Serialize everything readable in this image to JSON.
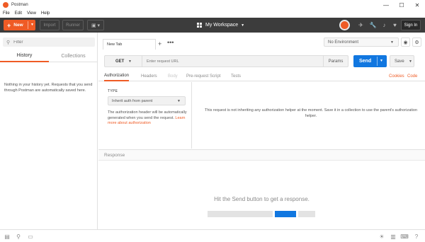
{
  "window": {
    "title": "Postman",
    "controls": {
      "minimize": "—",
      "maximize": "☐",
      "close": "✕"
    }
  },
  "menu": [
    "File",
    "Edit",
    "View",
    "Help"
  ],
  "toolbar": {
    "new_label": "New",
    "import_label": "Import",
    "runner_label": "Runner",
    "workspace_label": "My Workspace",
    "signin_label": "Sign In"
  },
  "sidebar": {
    "filter_placeholder": "Filter",
    "tabs": [
      "History",
      "Collections"
    ],
    "active_tab": "History",
    "empty_message": "Nothing in your history yet. Requests that you send through Postman are automatically saved here."
  },
  "request_tab": {
    "label": "New Tab"
  },
  "environment": {
    "selected": "No Environment"
  },
  "request": {
    "method": "GET",
    "url_placeholder": "Enter request URL",
    "params_label": "Params",
    "send_label": "Send",
    "save_label": "Save"
  },
  "subtabs": [
    "Authorization",
    "Headers",
    "Body",
    "Pre-request Script",
    "Tests"
  ],
  "subtab_links": [
    "Cookies",
    "Code"
  ],
  "auth": {
    "type_label": "TYPE",
    "type_value": "Inherit auth from parent",
    "desc_text": "The authorization header will be automatically generated when you send the request.",
    "learn_more": "Learn more about authorization",
    "message": "This request is not inheriting any authorization helper at the moment. Save it in a collection to use the parent's authorization helper."
  },
  "response": {
    "label": "Response",
    "hint": "Hit the Send button to get a response."
  },
  "colors": {
    "accent": "#ef5b25",
    "send_blue": "#1177e0",
    "toolbar_bg": "#3c3c3c"
  },
  "icons": [
    "postman-logo-icon",
    "sync-icon",
    "satellite-icon",
    "wrench-icon",
    "bell-icon",
    "heart-icon",
    "search-icon",
    "eye-icon",
    "gear-icon",
    "sidebar-toggle-icon",
    "console-icon",
    "find-icon",
    "bulb-icon",
    "columns-icon",
    "keyboard-icon",
    "help-icon"
  ]
}
